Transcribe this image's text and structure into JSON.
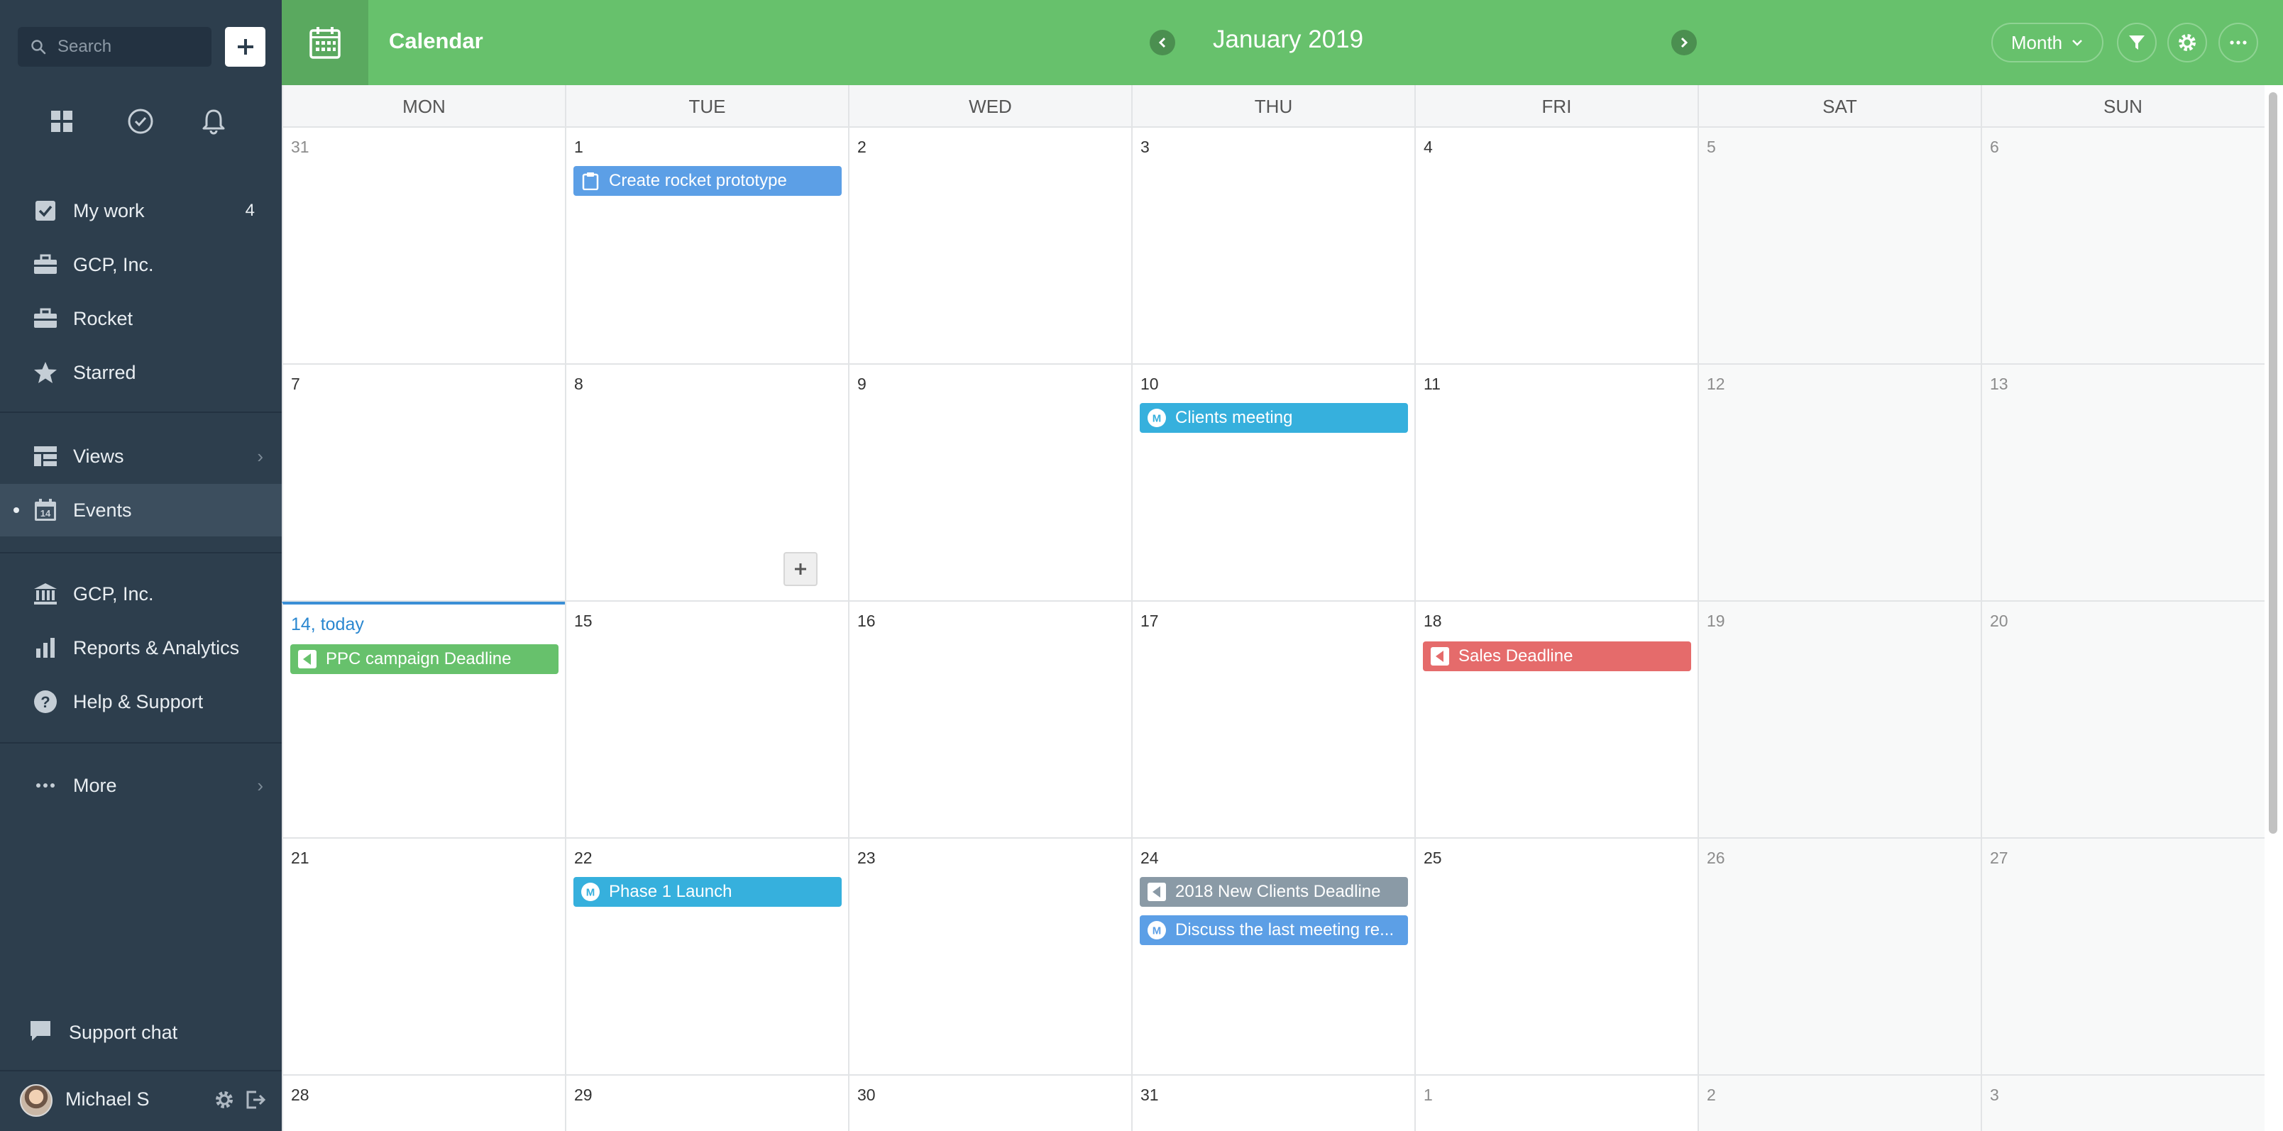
{
  "sidebar": {
    "search_placeholder": "Search",
    "top_icons": [
      "dashboard-icon",
      "clock-check-icon",
      "bell-icon"
    ],
    "nav": [
      {
        "label": "My work",
        "count": "4",
        "icon": "checkbox-icon"
      },
      {
        "label": "GCP, Inc.",
        "icon": "briefcase-icon"
      },
      {
        "label": "Rocket",
        "icon": "briefcase-icon"
      },
      {
        "label": "Starred",
        "icon": "star-icon"
      }
    ],
    "nav2": [
      {
        "label": "Views",
        "icon": "views-icon"
      },
      {
        "label": "Events",
        "icon": "calendar-14-icon",
        "active": true
      }
    ],
    "nav3": [
      {
        "label": "GCP, Inc.",
        "icon": "bank-icon"
      },
      {
        "label": "Reports & Analytics",
        "icon": "bar-chart-icon"
      },
      {
        "label": "Help & Support",
        "icon": "question-icon"
      }
    ],
    "more_label": "More",
    "support_label": "Support chat",
    "user_name": "Michael S"
  },
  "header": {
    "title": "Calendar",
    "month_label": "January 2019",
    "view_label": "Month"
  },
  "calendar": {
    "weekdays": [
      "MON",
      "TUE",
      "WED",
      "THU",
      "FRI",
      "SAT",
      "SUN"
    ],
    "weeks": [
      [
        "31",
        "1",
        "2",
        "3",
        "4",
        "5",
        "6"
      ],
      [
        "7",
        "8",
        "9",
        "10",
        "11",
        "12",
        "13"
      ],
      [
        "14, today",
        "15",
        "16",
        "17",
        "18",
        "19",
        "20"
      ],
      [
        "21",
        "22",
        "23",
        "24",
        "25",
        "26",
        "27"
      ],
      [
        "28",
        "29",
        "30",
        "31",
        "1",
        "2",
        "3"
      ]
    ],
    "events": {
      "e0": {
        "label": "Create rocket prototype",
        "kind": "task"
      },
      "e1": {
        "label": "Clients meeting",
        "kind": "meeting"
      },
      "e2": {
        "label": "PPC campaign Deadline",
        "kind": "deadline"
      },
      "e3": {
        "label": "Sales Deadline",
        "kind": "deadline"
      },
      "e4": {
        "label": "Phase 1 Launch",
        "kind": "meeting"
      },
      "e5": {
        "label": "2018 New Clients Deadline",
        "kind": "deadline"
      },
      "e6": {
        "label": "Discuss the last meeting re...",
        "kind": "meeting"
      }
    }
  },
  "colors": {
    "header_green": "#67c16c",
    "sidebar_bg": "#2d3e4d",
    "event_blue": "#5c9fe6",
    "event_teal": "#36b0dd",
    "event_red": "#e56b6b",
    "event_gray": "#8a9aa6",
    "today_blue": "#2a87d0"
  }
}
